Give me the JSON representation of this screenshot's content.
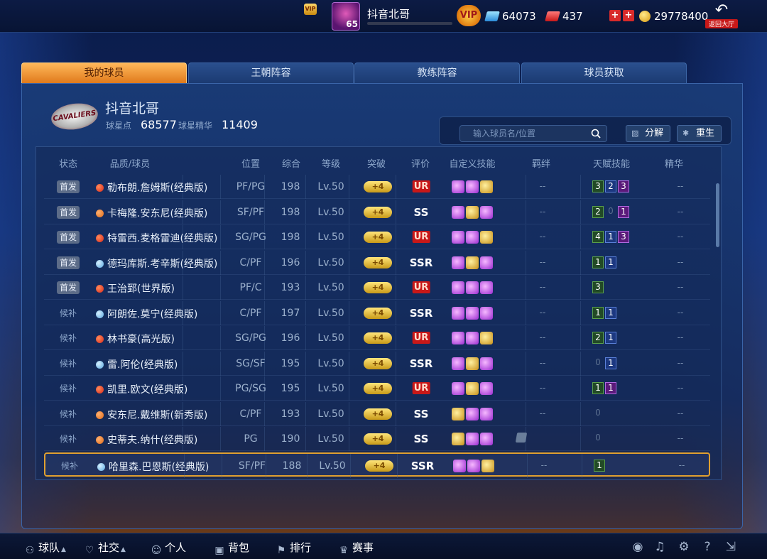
{
  "topbar": {
    "vip_mini": "VIP",
    "level": "65",
    "player_name": "抖音北哥",
    "vip_badge": "VIP",
    "gems": "64073",
    "tickets": "437",
    "coins": "29778400",
    "back_label": "返回大厅"
  },
  "tabs": [
    {
      "label": "我的球员",
      "active": true
    },
    {
      "label": "王朝阵容",
      "active": false
    },
    {
      "label": "教练阵容",
      "active": false
    },
    {
      "label": "球员获取",
      "active": false
    }
  ],
  "team": {
    "logo_text": "CAVALIERS",
    "owner_name": "抖音北哥",
    "star_points_label": "球星点",
    "star_points": "68577",
    "essence_label": "球星精华",
    "essence": "11409"
  },
  "search": {
    "placeholder": "输入球员名/位置"
  },
  "actions": {
    "decompose": "分解",
    "rebirth": "重生"
  },
  "table": {
    "headers": [
      "状态",
      "品质/球员",
      "位置",
      "综合",
      "等级",
      "突破",
      "评价",
      "自定义技能",
      "羁绊",
      "天赋技能",
      "精华"
    ],
    "rows": [
      {
        "status": "首发",
        "starter": true,
        "quality": "red",
        "name": "勒布朗.詹姆斯(经典版)",
        "pos": "PF/PG",
        "ovr": "198",
        "lv": "Lv.50",
        "break": "+4",
        "grade": "UR",
        "skills": [
          "p",
          "p",
          "g"
        ],
        "bond": "--",
        "talents": [
          [
            "3",
            "green"
          ],
          [
            "2",
            "blue"
          ],
          [
            "3",
            "purple"
          ]
        ],
        "essence": "--"
      },
      {
        "status": "首发",
        "starter": true,
        "quality": "orange",
        "name": "卡梅隆.安东尼(经典版)",
        "pos": "SF/PF",
        "ovr": "198",
        "lv": "Lv.50",
        "break": "+4",
        "grade": "SS",
        "skills": [
          "p",
          "g",
          "p"
        ],
        "bond": "--",
        "talents": [
          [
            "2",
            "green"
          ],
          [
            "0",
            "empty"
          ],
          [
            "1",
            "purple"
          ]
        ],
        "essence": "--"
      },
      {
        "status": "首发",
        "starter": true,
        "quality": "red",
        "name": "特雷西.麦格雷迪(经典版)",
        "pos": "SG/PG",
        "ovr": "198",
        "lv": "Lv.50",
        "break": "+4",
        "grade": "UR",
        "skills": [
          "p",
          "p",
          "g"
        ],
        "bond": "--",
        "talents": [
          [
            "4",
            "green"
          ],
          [
            "1",
            "blue"
          ],
          [
            "3",
            "purple"
          ]
        ],
        "essence": "--"
      },
      {
        "status": "首发",
        "starter": true,
        "quality": "blue",
        "name": "德玛库斯.考辛斯(经典版)",
        "pos": "C/PF",
        "ovr": "196",
        "lv": "Lv.50",
        "break": "+4",
        "grade": "SSR",
        "skills": [
          "p",
          "g",
          "p"
        ],
        "bond": "--",
        "talents": [
          [
            "1",
            "green"
          ],
          [
            "1",
            "blue"
          ]
        ],
        "essence": "--"
      },
      {
        "status": "首发",
        "starter": true,
        "quality": "red",
        "name": "王治郅(世界版)",
        "pos": "PF/C",
        "ovr": "193",
        "lv": "Lv.50",
        "break": "+4",
        "grade": "UR",
        "skills": [
          "p",
          "p",
          "p"
        ],
        "bond": "--",
        "talents": [
          [
            "3",
            "green"
          ]
        ],
        "essence": "--"
      },
      {
        "status": "候补",
        "starter": false,
        "quality": "blue",
        "name": "阿朗佐.莫宁(经典版)",
        "pos": "C/PF",
        "ovr": "197",
        "lv": "Lv.50",
        "break": "+4",
        "grade": "SSR",
        "skills": [
          "p",
          "p",
          "p"
        ],
        "bond": "--",
        "talents": [
          [
            "1",
            "green"
          ],
          [
            "1",
            "blue"
          ]
        ],
        "essence": "--"
      },
      {
        "status": "候补",
        "starter": false,
        "quality": "red",
        "name": "林书豪(高光版)",
        "pos": "SG/PG",
        "ovr": "196",
        "lv": "Lv.50",
        "break": "+4",
        "grade": "UR",
        "skills": [
          "p",
          "p",
          "g"
        ],
        "bond": "--",
        "talents": [
          [
            "2",
            "green"
          ],
          [
            "1",
            "blue"
          ]
        ],
        "essence": "--"
      },
      {
        "status": "候补",
        "starter": false,
        "quality": "blue",
        "name": "雷.阿伦(经典版)",
        "pos": "SG/SF",
        "ovr": "195",
        "lv": "Lv.50",
        "break": "+4",
        "grade": "SSR",
        "skills": [
          "p",
          "g",
          "p"
        ],
        "bond": "--",
        "talents": [
          [
            "0",
            "empty"
          ],
          [
            "1",
            "blue"
          ]
        ],
        "essence": "--"
      },
      {
        "status": "候补",
        "starter": false,
        "quality": "red",
        "name": "凯里.欧文(经典版)",
        "pos": "PG/SG",
        "ovr": "195",
        "lv": "Lv.50",
        "break": "+4",
        "grade": "UR",
        "skills": [
          "p",
          "g",
          "p"
        ],
        "bond": "--",
        "talents": [
          [
            "1",
            "green"
          ],
          [
            "1",
            "purple"
          ]
        ],
        "essence": "--"
      },
      {
        "status": "候补",
        "starter": false,
        "quality": "orange",
        "name": "安东尼.戴维斯(新秀版)",
        "pos": "C/PF",
        "ovr": "193",
        "lv": "Lv.50",
        "break": "+4",
        "grade": "SS",
        "skills": [
          "g",
          "p",
          "p"
        ],
        "bond": "--",
        "talents": [
          [
            "0",
            "empty"
          ]
        ],
        "essence": "--"
      },
      {
        "status": "候补",
        "starter": false,
        "quality": "orange",
        "name": "史蒂夫.纳什(经典版)",
        "pos": "PG",
        "ovr": "190",
        "lv": "Lv.50",
        "break": "+4",
        "grade": "SS",
        "skills": [
          "g",
          "p",
          "p"
        ],
        "bond": "",
        "talents": [
          [
            "0",
            "empty"
          ]
        ],
        "essence": "--"
      },
      {
        "status": "候补",
        "starter": false,
        "quality": "blue",
        "name": "哈里森.巴恩斯(经典版)",
        "pos": "SF/PF",
        "ovr": "188",
        "lv": "Lv.50",
        "break": "+4",
        "grade": "SSR",
        "skills": [
          "p",
          "p",
          "g"
        ],
        "bond": "--",
        "talents": [
          [
            "1",
            "green"
          ]
        ],
        "essence": "--",
        "selected": true
      }
    ]
  },
  "bottom_nav": [
    {
      "label": "球队",
      "icon": "person-icon",
      "caret": true
    },
    {
      "label": "社交",
      "icon": "heart-icon",
      "caret": true
    },
    {
      "label": "个人",
      "icon": "user-icon",
      "caret": false
    },
    {
      "label": "背包",
      "icon": "bag-icon",
      "caret": false
    },
    {
      "label": "排行",
      "icon": "rank-icon",
      "caret": false
    },
    {
      "label": "赛事",
      "icon": "trophy-icon",
      "caret": false
    }
  ]
}
